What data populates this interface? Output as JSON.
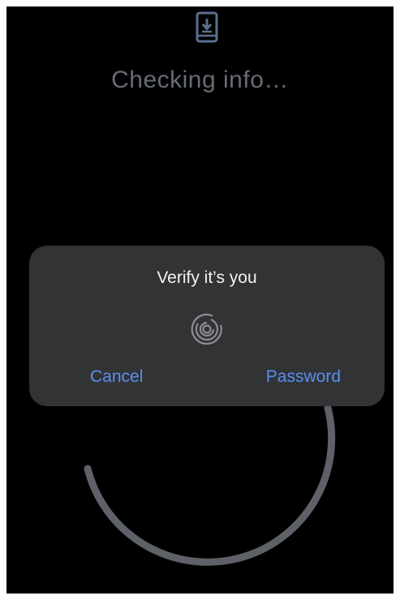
{
  "status": {
    "text": "Checking info…",
    "icon": "phone-download-icon"
  },
  "dialog": {
    "title": "Verify it’s you",
    "icon": "fingerprint-icon",
    "cancel_label": "Cancel",
    "password_label": "Password"
  },
  "colors": {
    "background": "#000000",
    "dialog": "#323335",
    "accent": "#5b8ef0",
    "muted_text": "#676c74",
    "ring": "#5e6168"
  }
}
